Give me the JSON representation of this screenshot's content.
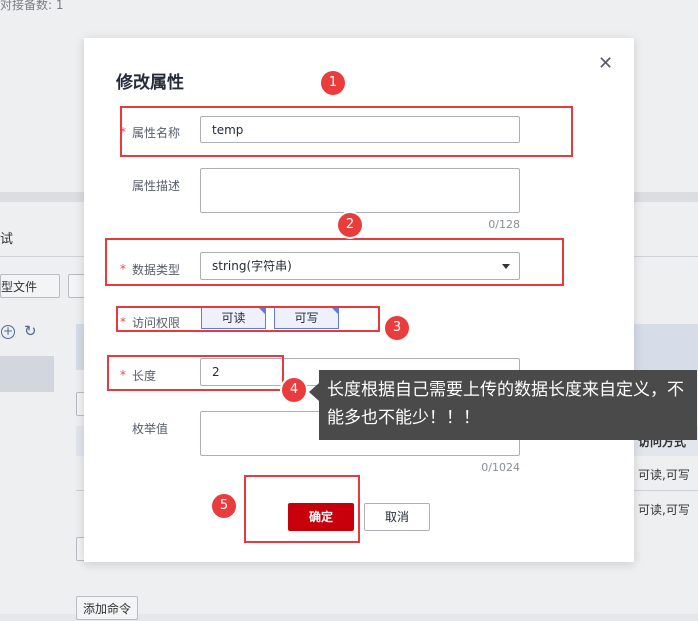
{
  "background": {
    "top_text": "对接备数: 1",
    "tab_partial": "试",
    "model_file_button": "型文件",
    "table_col_access": "访问方式",
    "row1_access": "可读,可写",
    "row2_access": "可读,可写",
    "add_command_button": "添加命令"
  },
  "dialog": {
    "title": "修改属性",
    "fields": {
      "name": {
        "label": "属性名称",
        "value": "temp"
      },
      "desc": {
        "label": "属性描述",
        "value": "",
        "counter": "0/128"
      },
      "type": {
        "label": "数据类型",
        "value": "string(字符串)"
      },
      "access": {
        "label": "访问权限",
        "options": [
          "可读",
          "可写"
        ]
      },
      "length": {
        "label": "长度",
        "value": "2"
      },
      "enum": {
        "label": "枚举值",
        "value": "",
        "counter": "0/1024"
      }
    },
    "required_mark": "*",
    "confirm_label": "确定",
    "cancel_label": "取消"
  },
  "annotations": {
    "badges": [
      "1",
      "2",
      "3",
      "4",
      "5"
    ],
    "tooltip": "长度根据自己需要上传的数据长度来自定义，不能多也不能少！！！",
    "colors": {
      "highlight": "#e8393f",
      "primary_button": "#c7000b",
      "toggle_border": "#5e7ce0"
    }
  }
}
